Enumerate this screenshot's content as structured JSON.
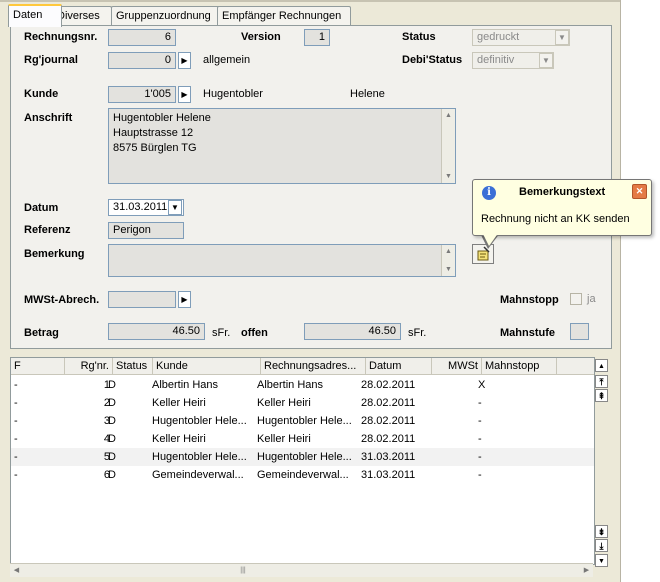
{
  "tabs": [
    "Daten",
    "Diverses",
    "Gruppenzuordnung",
    "Empfänger Rechnungen"
  ],
  "form": {
    "rechnungsnr_label": "Rechnungsnr.",
    "rechnungsnr_value": "6",
    "version_label": "Version",
    "version_value": "1",
    "status_label": "Status",
    "status_value": "gedruckt",
    "rgjournal_label": "Rg'journal",
    "rgjournal_value": "0",
    "rgjournal_text": "allgemein",
    "debistatus_label": "Debi'Status",
    "debistatus_value": "definitiv",
    "kunde_label": "Kunde",
    "kunde_value": "1'005",
    "kunde_name": "Hugentobler",
    "kunde_vorname": "Helene",
    "anschrift_label": "Anschrift",
    "anschrift_lines": [
      "Hugentobler Helene",
      "Hauptstrasse 12",
      "8575 Bürglen TG"
    ],
    "datum_label": "Datum",
    "datum_value": "31.03.2011",
    "referenz_label": "Referenz",
    "referenz_value": "Perigon",
    "bemerkung_label": "Bemerkung",
    "bemerkung_value": "",
    "mwst_label": "MWSt-Abrech.",
    "mwst_value": "",
    "mahnstopp_label": "Mahnstopp",
    "mahnstopp_check_label": "ja",
    "betrag_label": "Betrag",
    "betrag_value": "46.50",
    "betrag_currency": "sFr.",
    "offen_label": "offen",
    "offen_value": "46.50",
    "offen_currency": "sFr.",
    "mahnstufe_label": "Mahnstufe",
    "mahnstufe_value": ""
  },
  "tooltip": {
    "title": "Bemerkungstext",
    "text": "Rechnung nicht an KK senden"
  },
  "table": {
    "columns": [
      "F",
      "Rg'nr.",
      "Status",
      "Kunde",
      "Rechnungsadres...",
      "Datum",
      "MWSt",
      "Mahnstopp"
    ],
    "rows": [
      [
        "-",
        "1",
        "D",
        "Albertin Hans",
        "Albertin Hans",
        "28.02.2011",
        "",
        "X"
      ],
      [
        "-",
        "2",
        "D",
        "Keller Heiri",
        "Keller Heiri",
        "28.02.2011",
        "",
        "-"
      ],
      [
        "-",
        "3",
        "D",
        "Hugentobler Hele...",
        "Hugentobler Hele...",
        "28.02.2011",
        "",
        "-"
      ],
      [
        "-",
        "4",
        "D",
        "Keller Heiri",
        "Keller Heiri",
        "28.02.2011",
        "",
        "-"
      ],
      [
        "-",
        "5",
        "D",
        "Hugentobler Hele...",
        "Hugentobler Hele...",
        "31.03.2011",
        "",
        "-"
      ],
      [
        "-",
        "6",
        "D",
        "Gemeindeverwal...",
        "Gemeindeverwal...",
        "31.03.2011",
        "",
        "-"
      ]
    ]
  }
}
